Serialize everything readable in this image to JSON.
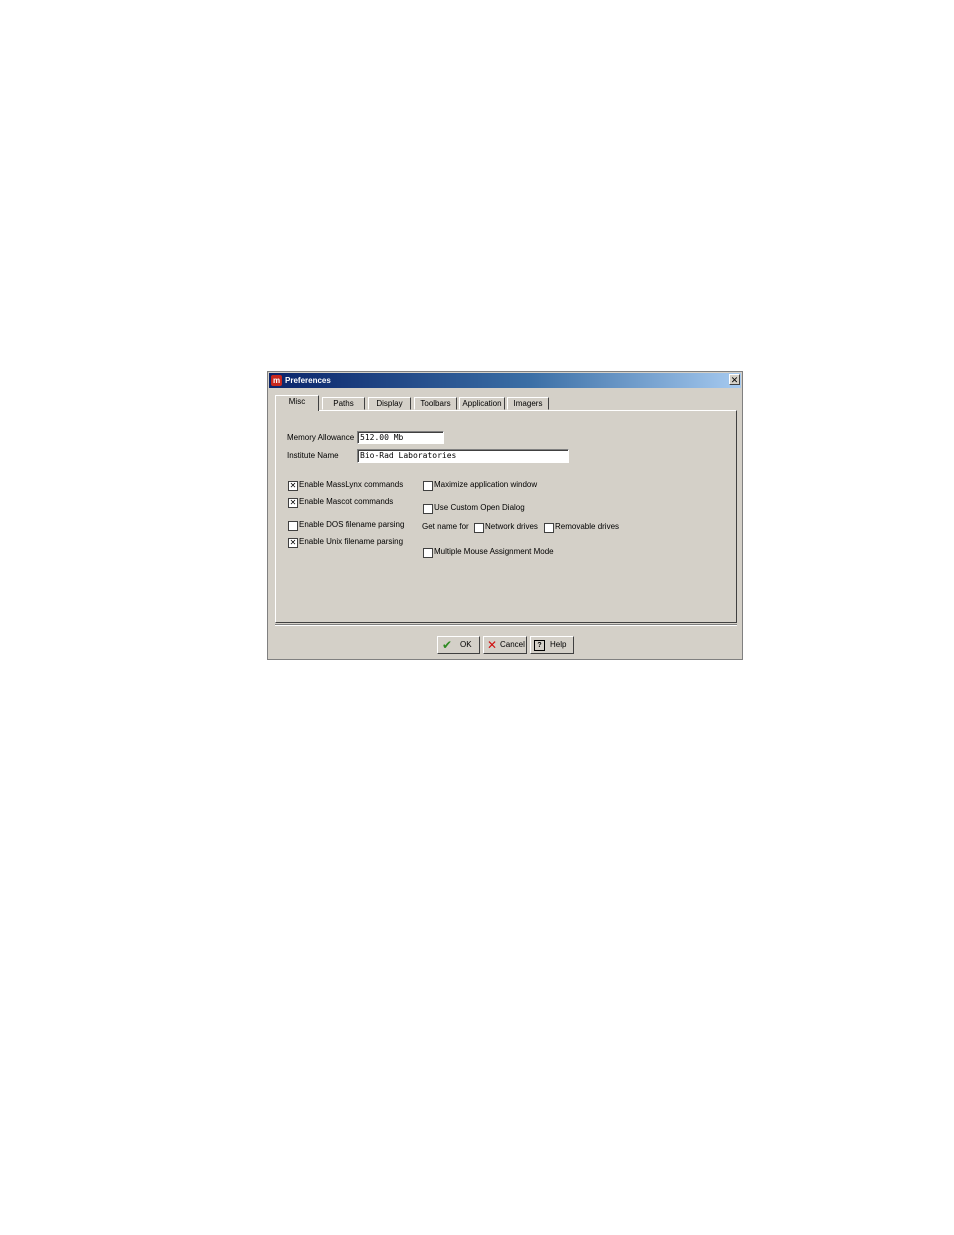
{
  "window": {
    "title": "Preferences",
    "app_icon": "m",
    "close_glyph": "✕"
  },
  "tabs": [
    {
      "label": "Misc",
      "active": true
    },
    {
      "label": "Paths",
      "active": false
    },
    {
      "label": "Display",
      "active": false
    },
    {
      "label": "Toolbars",
      "active": false
    },
    {
      "label": "Application",
      "active": false
    },
    {
      "label": "Imagers",
      "active": false
    }
  ],
  "misc": {
    "memory_allowance_label": "Memory Allowance",
    "memory_allowance_value": "512.00 Mb",
    "institute_name_label": "Institute Name",
    "institute_name_value": "Bio-Rad Laboratories",
    "left_options": [
      {
        "label": "Enable MassLynx commands",
        "checked": true
      },
      {
        "label": "Enable Mascot commands",
        "checked": true
      },
      {
        "label": "Enable DOS filename parsing",
        "checked": false
      },
      {
        "label": "Enable Unix filename parsing",
        "checked": true
      }
    ],
    "maximize_window": {
      "label": "Maximize application window",
      "checked": false
    },
    "custom_open_dialog": {
      "label": "Use Custom Open Dialog",
      "checked": false
    },
    "get_name_for_label": "Get name for",
    "network_drives": {
      "label": "Network drives",
      "checked": false
    },
    "removable_drives": {
      "label": "Removable drives",
      "checked": false
    },
    "mouse_assignment": {
      "label": "Multiple Mouse Assignment Mode",
      "checked": false
    }
  },
  "buttons": {
    "ok": "OK",
    "cancel": "Cancel",
    "help": "Help"
  },
  "check_glyph": "✕",
  "icons": {
    "ok": "checkmark-icon",
    "cancel": "x-icon",
    "help": "help-icon"
  },
  "colors": {
    "ok_icon": "#2e8b22",
    "cancel_icon": "#d01010",
    "titlebar_start": "#0a246a",
    "titlebar_end": "#a6caf0",
    "dialog_bg": "#d4d0c8"
  }
}
